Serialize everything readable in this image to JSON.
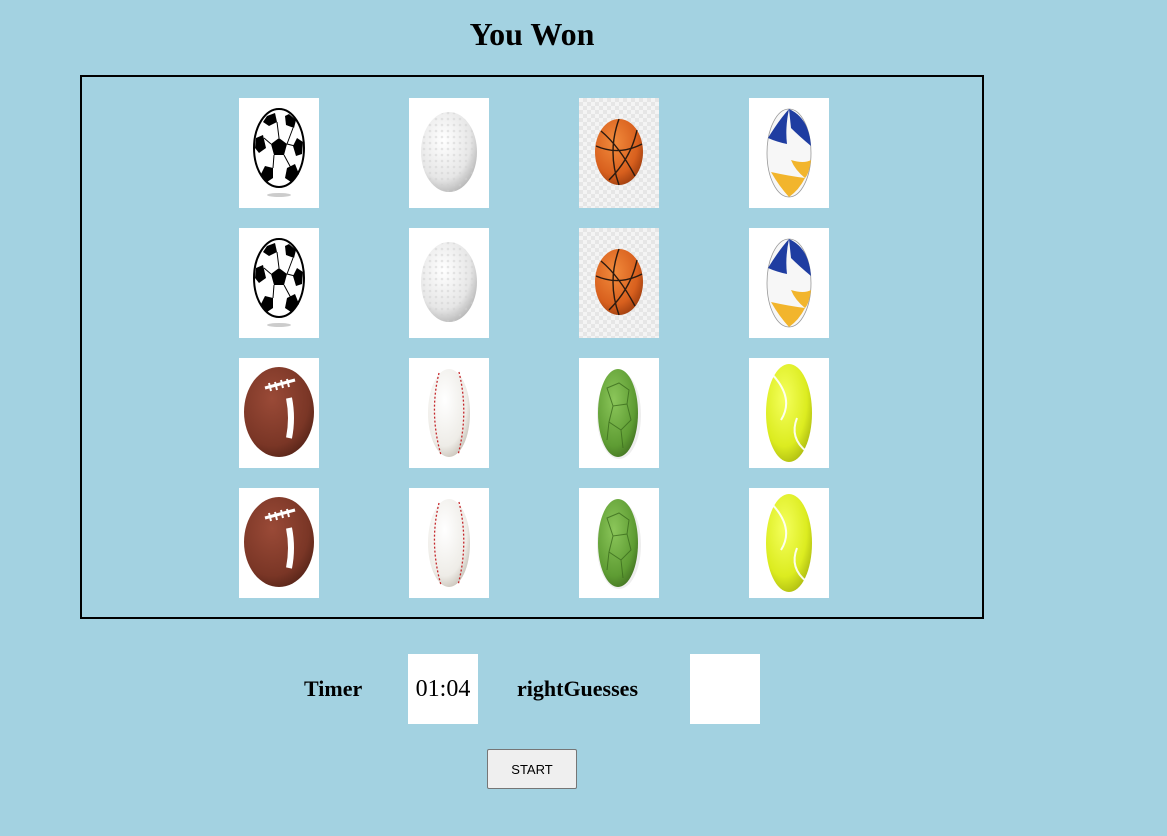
{
  "game": {
    "status": "You Won",
    "timer_label": "Timer",
    "timer_value": "01:04",
    "right_guesses_label": "rightGuesses",
    "right_guesses_value": "",
    "start_label": "START"
  },
  "board": {
    "rows": 4,
    "columns": 4,
    "cards": [
      "soccer-ball",
      "golf-ball",
      "basketball",
      "volleyball",
      "soccer-ball",
      "golf-ball",
      "basketball",
      "volleyball",
      "american-football",
      "baseball",
      "handball",
      "tennis-ball",
      "american-football",
      "baseball",
      "handball",
      "tennis-ball"
    ]
  },
  "colors": {
    "page_background": "#a3d2e1",
    "board_border": "#000000",
    "card_background": "#ffffff"
  }
}
